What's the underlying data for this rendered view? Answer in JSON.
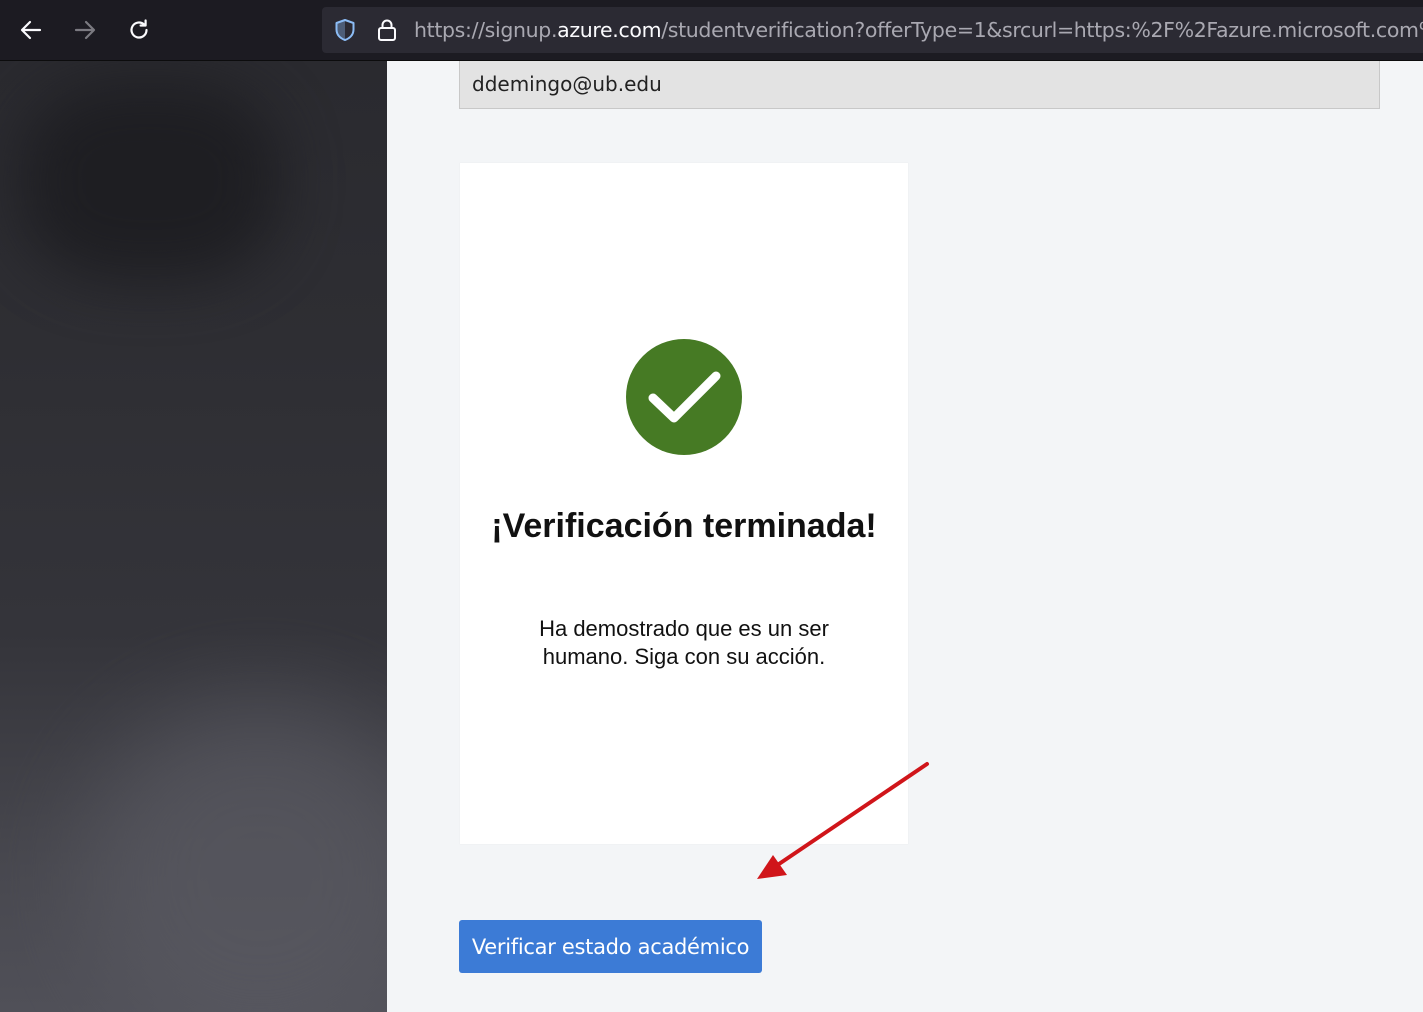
{
  "browser": {
    "url_prefix": "https://signup.",
    "url_host": "azure.com",
    "url_rest": "/studentverification?offerType=1&srcurl=https:%2F%2Fazure.microsoft.com%2Ffree%"
  },
  "form": {
    "email_value": "ddemingo@ub.edu"
  },
  "verification": {
    "title": "¡Verificación terminada!",
    "message": "Ha demostrado que es un ser humano. Siga con su acción.",
    "accent_color": "#467a24"
  },
  "actions": {
    "verify_button_label": "Verificar estado académico",
    "button_color": "#3c7bd6"
  },
  "annotation": {
    "arrow_color": "#d0151a"
  }
}
